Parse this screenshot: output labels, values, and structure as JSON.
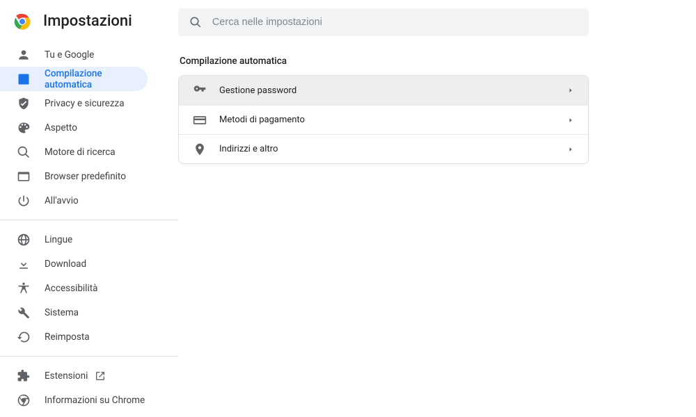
{
  "header": {
    "title": "Impostazioni"
  },
  "search": {
    "placeholder": "Cerca nelle impostazioni"
  },
  "sidebar": {
    "group1": [
      {
        "label": "Tu e Google"
      },
      {
        "label": "Compilazione automatica"
      },
      {
        "label": "Privacy e sicurezza"
      },
      {
        "label": "Aspetto"
      },
      {
        "label": "Motore di ricerca"
      },
      {
        "label": "Browser predefinito"
      },
      {
        "label": "All'avvio"
      }
    ],
    "group2": [
      {
        "label": "Lingue"
      },
      {
        "label": "Download"
      },
      {
        "label": "Accessibilità"
      },
      {
        "label": "Sistema"
      },
      {
        "label": "Reimposta"
      }
    ],
    "group3": [
      {
        "label": "Estensioni"
      },
      {
        "label": "Informazioni su Chrome"
      }
    ]
  },
  "main": {
    "section_title": "Compilazione automatica",
    "rows": [
      {
        "label": "Gestione password"
      },
      {
        "label": "Metodi di pagamento"
      },
      {
        "label": "Indirizzi e altro"
      }
    ]
  }
}
